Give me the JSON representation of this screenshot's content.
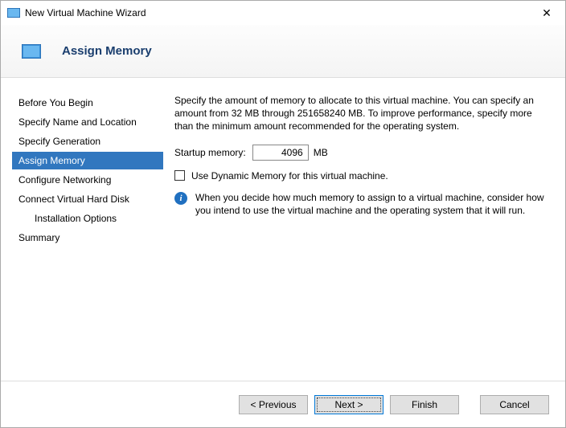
{
  "window": {
    "title": "New Virtual Machine Wizard",
    "close_glyph": "✕"
  },
  "header": {
    "title": "Assign Memory"
  },
  "sidebar": {
    "items": [
      {
        "label": "Before You Begin",
        "active": false,
        "indent": false
      },
      {
        "label": "Specify Name and Location",
        "active": false,
        "indent": false
      },
      {
        "label": "Specify Generation",
        "active": false,
        "indent": false
      },
      {
        "label": "Assign Memory",
        "active": true,
        "indent": false
      },
      {
        "label": "Configure Networking",
        "active": false,
        "indent": false
      },
      {
        "label": "Connect Virtual Hard Disk",
        "active": false,
        "indent": false
      },
      {
        "label": "Installation Options",
        "active": false,
        "indent": true
      },
      {
        "label": "Summary",
        "active": false,
        "indent": false
      }
    ]
  },
  "content": {
    "description": "Specify the amount of memory to allocate to this virtual machine. You can specify an amount from 32 MB through 251658240 MB. To improve performance, specify more than the minimum amount recommended for the operating system.",
    "memory_label": "Startup memory:",
    "memory_value": "4096",
    "memory_unit": "MB",
    "dynamic_checkbox_label": "Use Dynamic Memory for this virtual machine.",
    "info_text": "When you decide how much memory to assign to a virtual machine, consider how you intend to use the virtual machine and the operating system that it will run."
  },
  "footer": {
    "previous": "< Previous",
    "next": "Next >",
    "finish": "Finish",
    "cancel": "Cancel"
  }
}
